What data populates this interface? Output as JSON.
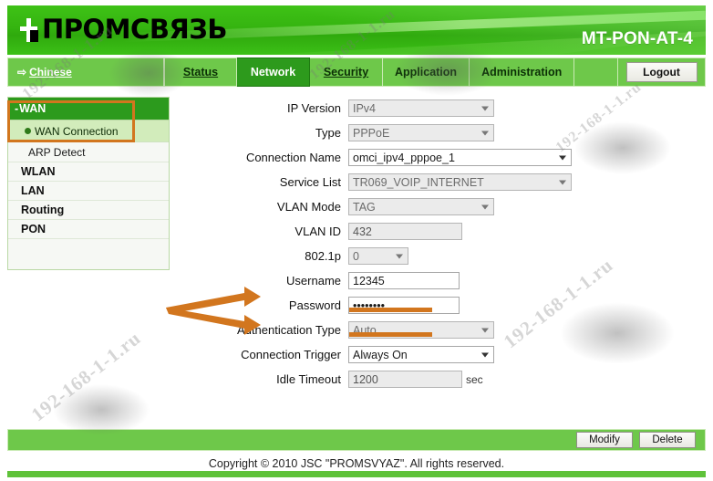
{
  "header": {
    "logo_text": "ПРОМСВЯЗЬ",
    "logo_icon": "plug-icon",
    "model": "MT-PON-AT-4"
  },
  "nav": {
    "language_link": "Chinese",
    "language_icon": "arrow-right-icon",
    "tabs": [
      {
        "label": "Status",
        "active": false
      },
      {
        "label": "Network",
        "active": true
      },
      {
        "label": "Security",
        "active": false
      },
      {
        "label": "Application",
        "active": false
      },
      {
        "label": "Administration",
        "active": false
      }
    ],
    "logout_label": "Logout"
  },
  "sidebar": {
    "group": "WAN",
    "group_prefix": "-",
    "selected": "WAN Connection",
    "items": [
      {
        "label": "WAN Connection",
        "type": "sub",
        "selected": true
      },
      {
        "label": "ARP Detect",
        "type": "sub2",
        "selected": false
      },
      {
        "label": "WLAN",
        "type": "item",
        "selected": false
      },
      {
        "label": "LAN",
        "type": "item",
        "selected": false
      },
      {
        "label": "Routing",
        "type": "item",
        "selected": false
      },
      {
        "label": "PON",
        "type": "item",
        "selected": false
      }
    ]
  },
  "form": {
    "ip_version": {
      "label": "IP Version",
      "value": "IPv4",
      "disabled": true
    },
    "type": {
      "label": "Type",
      "value": "PPPoE",
      "disabled": true
    },
    "connection_name": {
      "label": "Connection Name",
      "value": "omci_ipv4_pppoe_1",
      "disabled": false
    },
    "service_list": {
      "label": "Service List",
      "value": "TR069_VOIP_INTERNET",
      "disabled": true
    },
    "vlan_mode": {
      "label": "VLAN Mode",
      "value": "TAG",
      "disabled": true
    },
    "vlan_id": {
      "label": "VLAN ID",
      "value": "432",
      "disabled": true
    },
    "dot1p": {
      "label": "802.1p",
      "value": "0",
      "disabled": true
    },
    "username": {
      "label": "Username",
      "value": "12345",
      "disabled": false
    },
    "password": {
      "label": "Password",
      "value": "••••••••",
      "disabled": false
    },
    "auth_type": {
      "label": "Authentication Type",
      "value": "Auto",
      "disabled": true
    },
    "connection_trigger": {
      "label": "Connection Trigger",
      "value": "Always On",
      "disabled": false
    },
    "idle_timeout": {
      "label": "Idle Timeout",
      "value": "1200",
      "unit": "sec",
      "disabled": true
    }
  },
  "actions": {
    "modify_label": "Modify",
    "delete_label": "Delete"
  },
  "footer": {
    "copyright": "Copyright © 2010 JSC \"PROMSVYAZ\". All rights reserved."
  },
  "watermark": {
    "text": "192-168-1-1.ru"
  },
  "annotation": {
    "highlight_color": "#d2761e",
    "accent_green": "#2d9a1c",
    "nav_green": "#6ec84a"
  }
}
